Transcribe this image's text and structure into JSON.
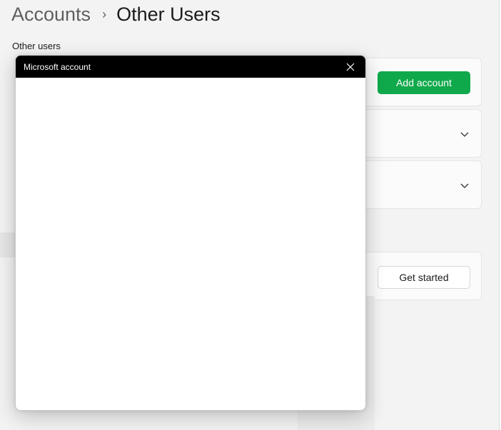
{
  "breadcrumb": {
    "parent": "Accounts",
    "separator": "›",
    "current": "Other Users"
  },
  "section": {
    "title": "Other users"
  },
  "buttons": {
    "add_account": "Add account",
    "get_started": "Get started"
  },
  "dialog": {
    "title": "Microsoft account",
    "close_icon": "close-icon"
  },
  "icons": {
    "expand": "chevron-down-icon"
  },
  "colors": {
    "accent": "#0fa94b",
    "titlebar": "#000000",
    "background": "#f3f3f3"
  }
}
